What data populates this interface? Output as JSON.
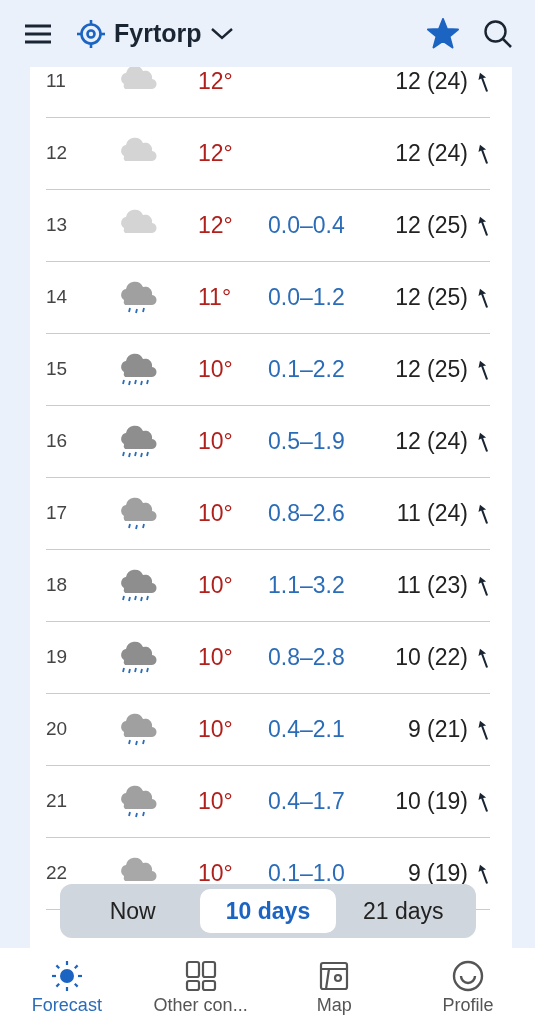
{
  "header": {
    "location": "Fyrtorp",
    "favorite": true
  },
  "rows": [
    {
      "hour": "11",
      "kind": "cloud-light",
      "temp": "12°",
      "wind": "12 (24)"
    },
    {
      "hour": "12",
      "kind": "cloud-light",
      "temp": "12°",
      "wind": "12 (24)"
    },
    {
      "hour": "13",
      "kind": "cloud-light",
      "temp": "12°",
      "precip": "0.0–0.4",
      "wind": "12 (25)"
    },
    {
      "hour": "14",
      "kind": "rain-light",
      "temp": "11°",
      "precip": "0.0–1.2",
      "wind": "12 (25)"
    },
    {
      "hour": "15",
      "kind": "rain",
      "temp": "10°",
      "precip": "0.1–2.2",
      "wind": "12 (25)"
    },
    {
      "hour": "16",
      "kind": "rain",
      "temp": "10°",
      "precip": "0.5–1.9",
      "wind": "12 (24)"
    },
    {
      "hour": "17",
      "kind": "rain-light",
      "temp": "10°",
      "precip": "0.8–2.6",
      "wind": "11 (24)"
    },
    {
      "hour": "18",
      "kind": "rain",
      "temp": "10°",
      "precip": "1.1–3.2",
      "wind": "11 (23)"
    },
    {
      "hour": "19",
      "kind": "rain",
      "temp": "10°",
      "precip": "0.8–2.8",
      "wind": "10 (22)"
    },
    {
      "hour": "20",
      "kind": "rain-light",
      "temp": "10°",
      "precip": "0.4–2.1",
      "wind": "9 (21)"
    },
    {
      "hour": "21",
      "kind": "rain-light",
      "temp": "10°",
      "precip": "0.4–1.7",
      "wind": "10 (19)"
    },
    {
      "hour": "22",
      "kind": "cloud",
      "temp": "10°",
      "precip": "0.1–1.0",
      "wind": "9 (19)"
    }
  ],
  "period_tabs": [
    {
      "label": "Now",
      "selected": false
    },
    {
      "label": "10 days",
      "selected": true
    },
    {
      "label": "21 days",
      "selected": false
    }
  ],
  "bottom_nav": [
    {
      "label": "Forecast",
      "kind": "sun",
      "selected": true
    },
    {
      "label": "Other con...",
      "kind": "grid",
      "selected": false
    },
    {
      "label": "Map",
      "kind": "map",
      "selected": false
    },
    {
      "label": "Profile",
      "kind": "smile",
      "selected": false
    }
  ]
}
